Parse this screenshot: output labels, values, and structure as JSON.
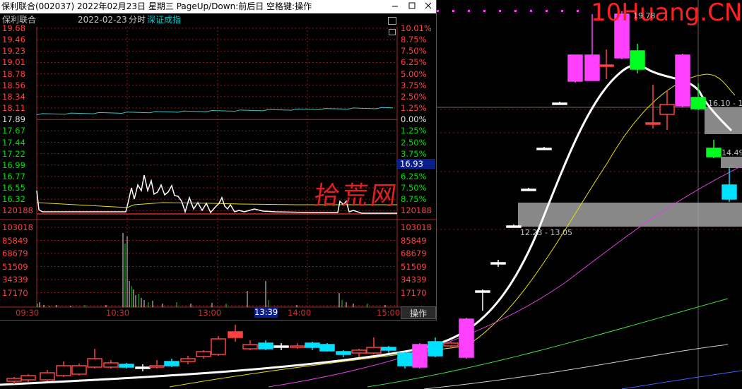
{
  "background_chart": {
    "label_high": "19.78",
    "label_range1": "16.10 - 1",
    "label_range2": "14.49",
    "label_range3": "12.23 - 13.05"
  },
  "watermark": {
    "site": "10Huang.CN",
    "seal": "拾荒网"
  },
  "window": {
    "title": "保利联合(002037) 2022年02月23日 星期三 PageUp/Down:前后日 空格键:操作",
    "stock_name": "保利联合",
    "date": "2022-02-23",
    "mode": "分时",
    "index_label": "深证成指"
  },
  "price_axis_left": [
    "19.68",
    "19.46",
    "19.23",
    "19.01",
    "18.78",
    "18.56",
    "18.34",
    "18.11",
    "17.89",
    "17.67",
    "17.44",
    "17.22",
    "16.99",
    "16.77",
    "16.55",
    "16.32",
    "120188"
  ],
  "pct_axis_right": [
    "10.01%",
    "8.75%",
    "7.50%",
    "6.25%",
    "5.00%",
    "3.75%",
    "2.50%",
    "1.25%",
    "0.00%",
    "1.25%",
    "2.50%",
    "3.75%",
    "",
    "6.25%",
    "7.50%",
    "8.75%",
    "120188"
  ],
  "current_price": "16.93",
  "volume_axis_left": [
    "103018",
    "85849",
    "68679",
    "51509",
    "34339",
    "17170"
  ],
  "volume_axis_right": [
    "103018",
    "85849",
    "68679",
    "51509",
    "34339",
    "17170"
  ],
  "time_axis": [
    "09:30",
    "10:30",
    "13:00",
    "14:00",
    "15:00"
  ],
  "time_cursor": "13:39",
  "op_button": "操作",
  "colors": {
    "up": "#ff4040",
    "down": "#00e0ff",
    "line": "#ffffff",
    "avg": "#e8e000",
    "index": "#40c0c0",
    "grid": "#8b1a1a"
  }
}
